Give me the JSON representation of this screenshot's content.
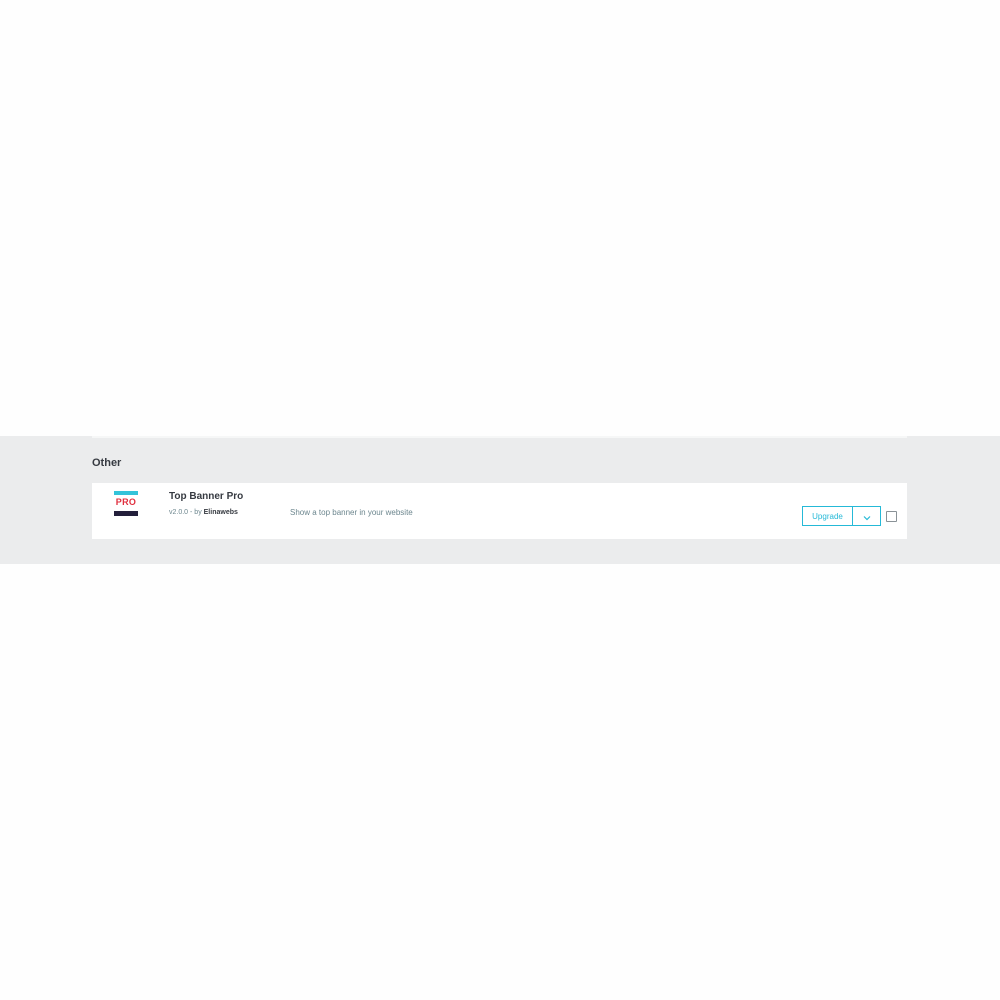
{
  "section": {
    "title": "Other"
  },
  "module": {
    "logo_text": "PRO",
    "name": "Top Banner Pro",
    "version": "v2.0.0",
    "by_label": " - by ",
    "author": "Elinawebs",
    "description": "Show a top banner in your website",
    "upgrade_label": "Upgrade",
    "dropdown_icon": "chevron-down-icon"
  },
  "colors": {
    "accent": "#25b9d7",
    "section_bg": "#ebeced",
    "logo_top": "#33c3d9",
    "logo_text": "#e02f3e",
    "logo_bottom": "#231f3b"
  }
}
